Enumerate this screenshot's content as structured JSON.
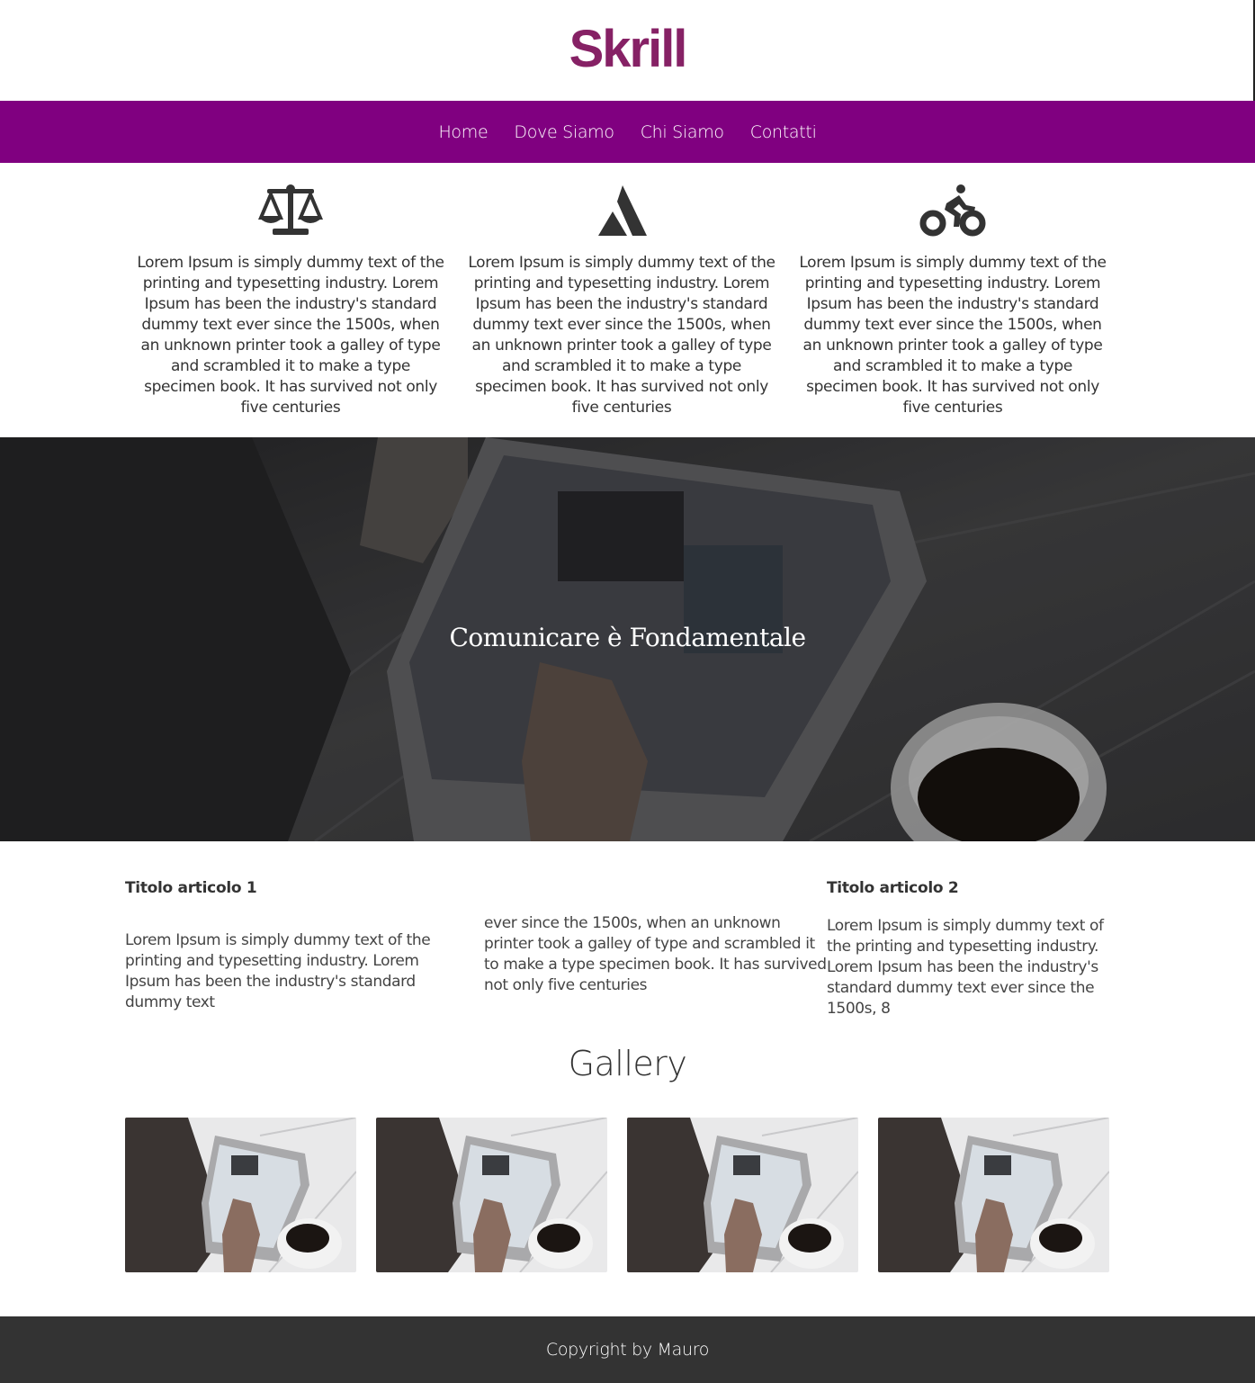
{
  "brand": {
    "logo_text": "Skrill",
    "color": "#862165"
  },
  "nav": {
    "background": "#800080",
    "items": [
      {
        "label": "Home"
      },
      {
        "label": "Dove Siamo"
      },
      {
        "label": "Chi Siamo"
      },
      {
        "label": "Contatti"
      }
    ]
  },
  "features": [
    {
      "icon": "balance-scale-icon",
      "text": "Lorem Ipsum is simply dummy text of the printing and typesetting industry. Lorem Ipsum has been the industry's standard dummy text ever since the 1500s, when an unknown printer took a galley of type and scrambled it to make a type specimen book. It has survived not only five centuries"
    },
    {
      "icon": "atlassian-icon",
      "text": "Lorem Ipsum is simply dummy text of the printing and typesetting industry. Lorem Ipsum has been the industry's standard dummy text ever since the 1500s, when an unknown printer took a galley of type and scrambled it to make a type specimen book. It has survived not only five centuries"
    },
    {
      "icon": "cyclist-icon",
      "text": "Lorem Ipsum is simply dummy text of the printing and typesetting industry. Lorem Ipsum has been the industry's standard dummy text ever since the 1500s, when an unknown printer took a galley of type and scrambled it to make a type specimen book. It has survived not only five centuries"
    }
  ],
  "hero": {
    "title": "Comunicare è Fondamentale"
  },
  "articles": {
    "a1_title": "Titolo articolo 1",
    "a1_text_part1": "Lorem Ipsum is simply dummy text of the printing and typesetting industry. Lorem Ipsum has been the industry's standard dummy text",
    "a1_text_part2": "ever since the 1500s, when an unknown printer took a galley of type and scrambled it to make a type specimen book. It has survived not only five centuries",
    "a2_title": "Titolo articolo 2",
    "a2_text": "Lorem Ipsum is simply dummy text of the printing and typesetting industry. Lorem Ipsum has been the industry's standard dummy text ever since the 1500s, 8"
  },
  "gallery": {
    "title": "Gallery",
    "image_count": 4
  },
  "footer": {
    "text": "Copyright by Mauro",
    "background": "#333333"
  }
}
